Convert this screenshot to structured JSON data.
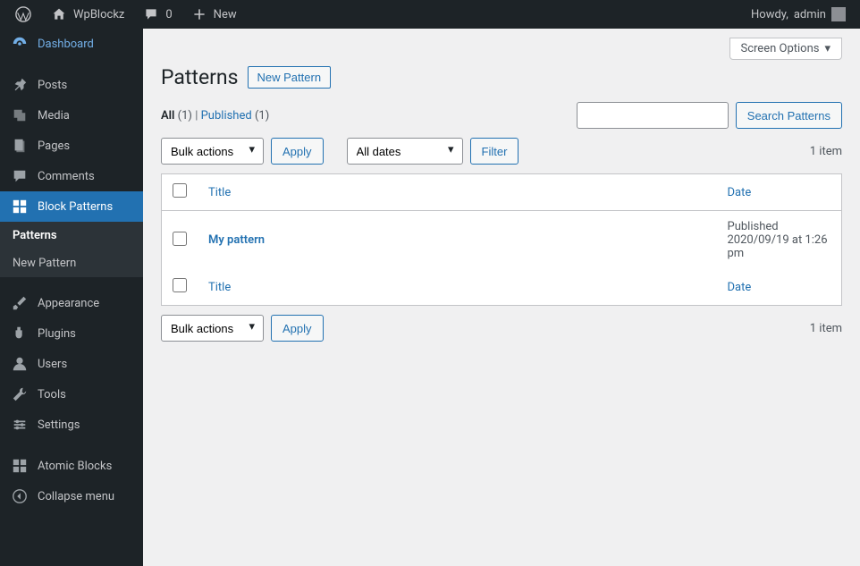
{
  "admin_bar": {
    "site_name": "WpBlockz",
    "comments_count": "0",
    "new_label": "New",
    "howdy_prefix": "Howdy,",
    "user_name": "admin"
  },
  "sidebar": {
    "dashboard": "Dashboard",
    "posts": "Posts",
    "media": "Media",
    "pages": "Pages",
    "comments": "Comments",
    "block_patterns": "Block Patterns",
    "submenu": {
      "patterns": "Patterns",
      "new_pattern": "New Pattern"
    },
    "appearance": "Appearance",
    "plugins": "Plugins",
    "users": "Users",
    "tools": "Tools",
    "settings": "Settings",
    "atomic_blocks": "Atomic Blocks",
    "collapse": "Collapse menu"
  },
  "screen_options": "Screen Options",
  "page": {
    "title": "Patterns",
    "add_new": "New Pattern"
  },
  "views": {
    "all_label": "All",
    "all_count": "(1)",
    "sep": " | ",
    "published_label": "Published",
    "published_count": "(1)"
  },
  "search": {
    "placeholder": "",
    "button": "Search Patterns"
  },
  "filters": {
    "bulk_actions": "Bulk actions",
    "apply": "Apply",
    "all_dates": "All dates",
    "filter": "Filter",
    "item_count": "1 item"
  },
  "table": {
    "col_title": "Title",
    "col_date": "Date",
    "rows": [
      {
        "title": "My pattern",
        "status": "Published",
        "date": "2020/09/19 at 1:26 pm"
      }
    ]
  }
}
